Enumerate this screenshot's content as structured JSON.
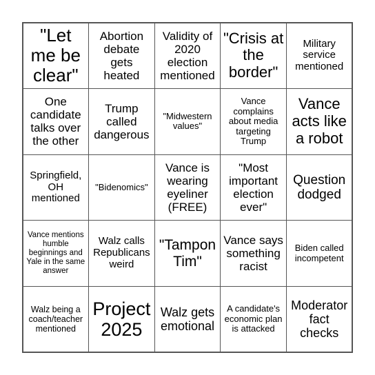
{
  "board": {
    "cells": [
      {
        "text": "\"Let me be clear\""
      },
      {
        "text": "Abortion debate gets heated"
      },
      {
        "text": "Validity of 2020 election mentioned"
      },
      {
        "text": "\"Crisis at the border\""
      },
      {
        "text": "Military service mentioned"
      },
      {
        "text": "One candidate talks over the other"
      },
      {
        "text": "Trump called dangerous"
      },
      {
        "text": "\"Midwestern values\""
      },
      {
        "text": "Vance complains about media targeting Trump"
      },
      {
        "text": "Vance acts like a robot"
      },
      {
        "text": "Springfield, OH mentioned"
      },
      {
        "text": "\"Bidenomics\""
      },
      {
        "text": "Vance is wearing eyeliner (FREE)"
      },
      {
        "text": "\"Most important election ever\""
      },
      {
        "text": "Question dodged"
      },
      {
        "text": "Vance mentions humble beginnings and Yale in the same answer"
      },
      {
        "text": "Walz calls Republicans weird"
      },
      {
        "text": "\"Tampon Tim\""
      },
      {
        "text": "Vance says something racist"
      },
      {
        "text": "Biden called incompetent"
      },
      {
        "text": "Walz being a coach/teacher mentioned"
      },
      {
        "text": "Project 2025"
      },
      {
        "text": "Walz gets emotional"
      },
      {
        "text": "A candidate's economic plan is attacked"
      },
      {
        "text": "Moderator fact checks"
      }
    ]
  }
}
